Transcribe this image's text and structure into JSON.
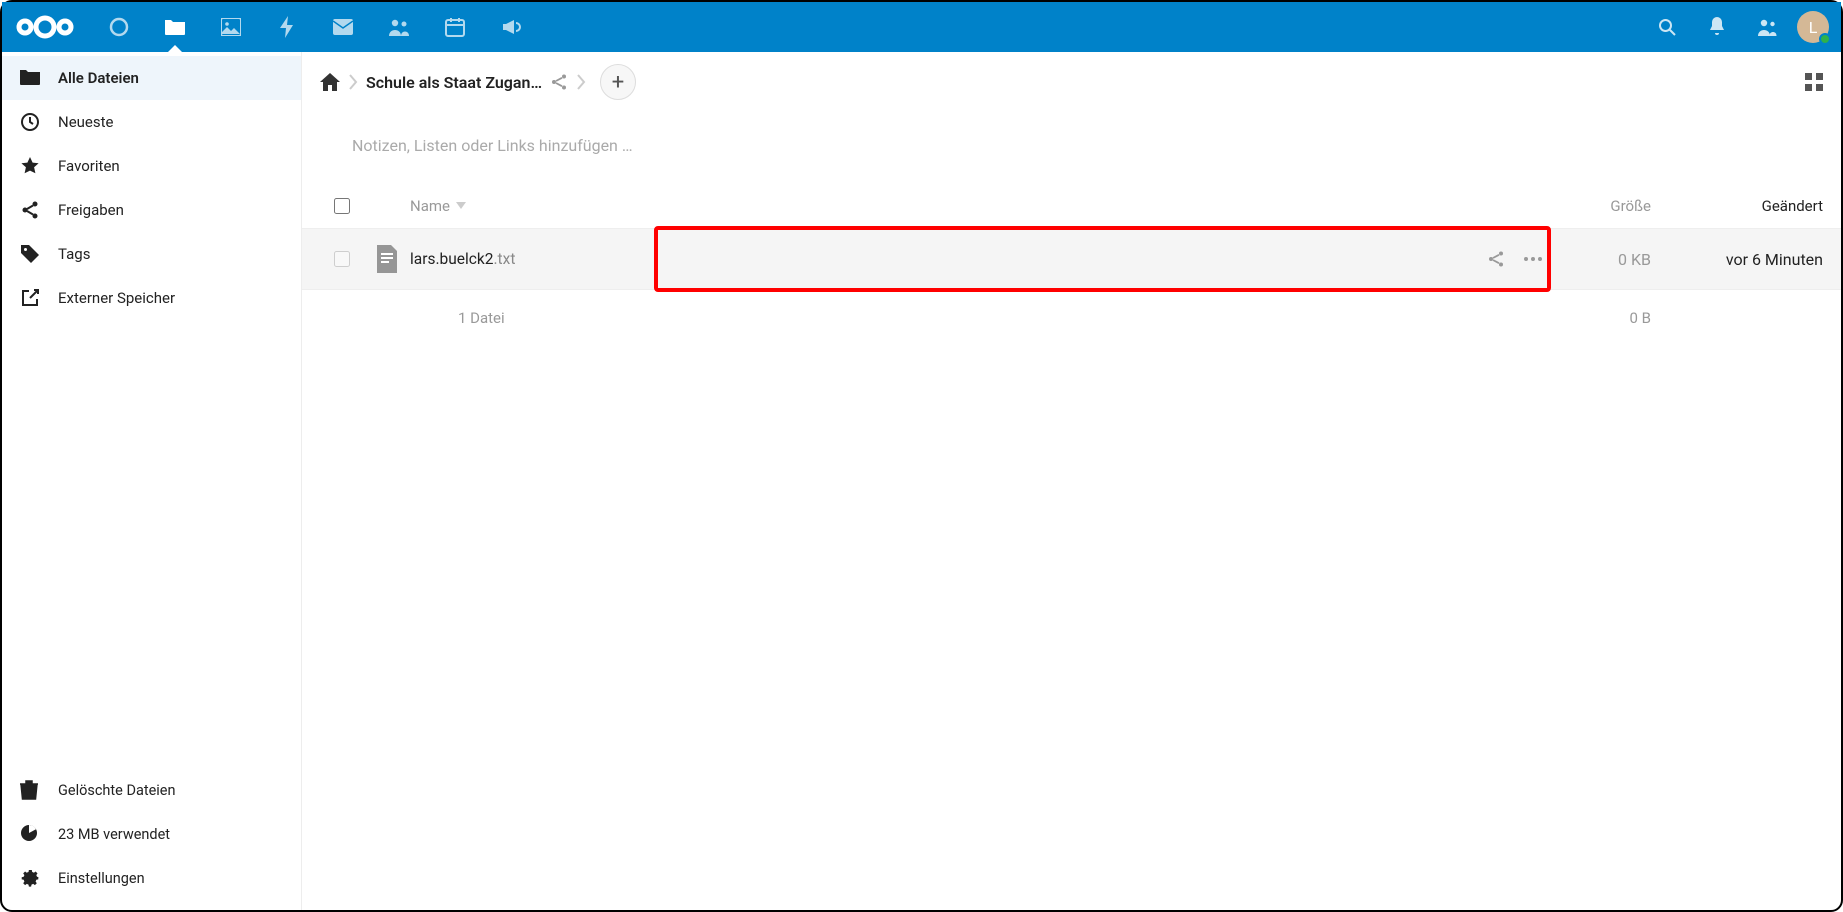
{
  "topbar": {
    "avatar_initial": "L"
  },
  "sidebar": {
    "items": [
      {
        "label": "Alle Dateien"
      },
      {
        "label": "Neueste"
      },
      {
        "label": "Favoriten"
      },
      {
        "label": "Freigaben"
      },
      {
        "label": "Tags"
      },
      {
        "label": "Externer Speicher"
      }
    ],
    "bottom": {
      "trash_label": "Gelöschte Dateien",
      "quota_label": "23 MB verwendet",
      "settings_label": "Einstellungen"
    }
  },
  "breadcrumb": {
    "folder": "Schule als Staat Zugan…"
  },
  "notes_placeholder": "Notizen, Listen oder Links hinzufügen …",
  "table": {
    "header": {
      "name": "Name",
      "size": "Größe",
      "modified": "Geändert"
    },
    "rows": [
      {
        "name": "lars.buelck2",
        "ext": ".txt",
        "size": "0 KB",
        "modified": "vor 6 Minuten"
      }
    ],
    "summary": {
      "count": "1 Datei",
      "size": "0 B"
    }
  }
}
